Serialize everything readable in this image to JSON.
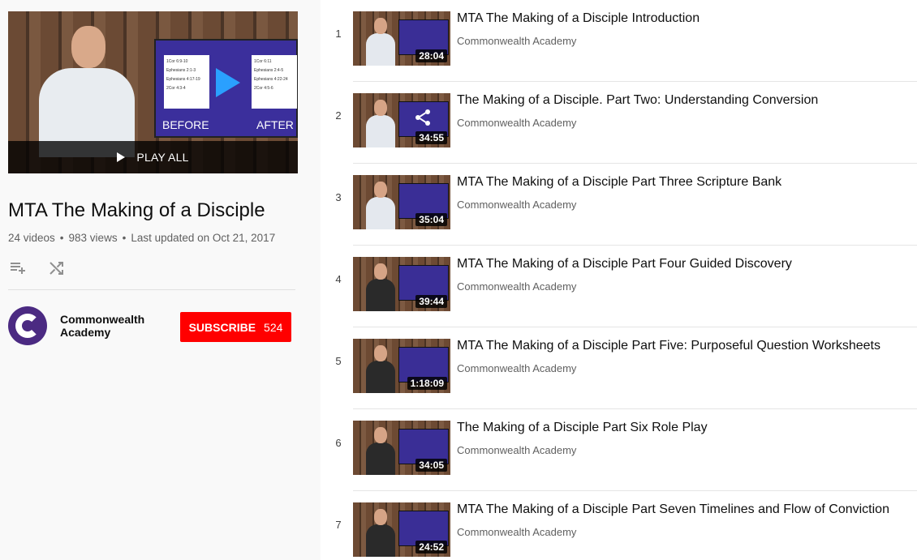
{
  "playlist": {
    "title": "MTA The Making of a Disciple",
    "video_count": "24 videos",
    "views": "983 views",
    "updated": "Last updated on Oct 21, 2017",
    "play_all_label": "PLAY ALL",
    "hero": {
      "left_lines": [
        "1Cor 6:9-10",
        "Ephesians 2:1-3",
        "Ephesians 4:17-19",
        "2Cor 4:3-4"
      ],
      "right_lines": [
        "1Cor 6:11",
        "Ephesians 2:4-5",
        "Ephesians 4:22-24",
        "2Cor 4:5-6"
      ],
      "before_label": "BEFORE",
      "after_label": "AFTER"
    }
  },
  "owner": {
    "name": "Commonwealth Academy",
    "subscribe_label": "SUBSCRIBE",
    "subscriber_count": "524"
  },
  "icons": {
    "add_to_queue": "playlist-add-icon",
    "shuffle": "shuffle-icon",
    "play": "play-icon",
    "share": "share-icon"
  },
  "colors": {
    "subscribe": "#ff0000",
    "avatar": "#4b2a82",
    "sidebar_bg": "#f9f9f9"
  },
  "videos": [
    {
      "index": "1",
      "title": "MTA The Making of a Disciple Introduction",
      "channel": "Commonwealth Academy",
      "duration": "28:04"
    },
    {
      "index": "2",
      "title": "The Making of a Disciple. Part Two: Understanding Conversion",
      "channel": "Commonwealth Academy",
      "duration": "34:55"
    },
    {
      "index": "3",
      "title": "MTA The Making of a Disciple Part Three Scripture Bank",
      "channel": "Commonwealth Academy",
      "duration": "35:04"
    },
    {
      "index": "4",
      "title": "MTA The Making of a Disciple Part Four Guided Discovery",
      "channel": "Commonwealth Academy",
      "duration": "39:44"
    },
    {
      "index": "5",
      "title": "MTA The Making of a Disciple Part Five: Purposeful Question Worksheets",
      "channel": "Commonwealth Academy",
      "duration": "1:18:09"
    },
    {
      "index": "6",
      "title": "The Making of a Disciple Part Six Role Play",
      "channel": "Commonwealth Academy",
      "duration": "34:05"
    },
    {
      "index": "7",
      "title": "MTA The Making of a Disciple Part Seven Timelines and Flow of Conviction",
      "channel": "Commonwealth Academy",
      "duration": "24:52"
    }
  ]
}
